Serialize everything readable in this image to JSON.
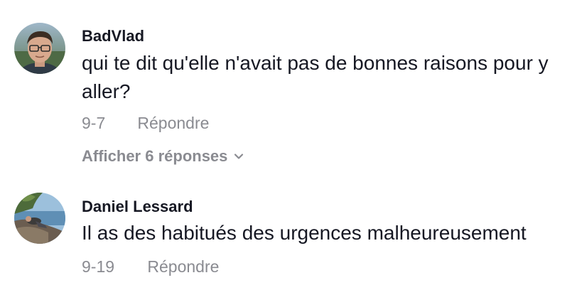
{
  "comments": [
    {
      "username": "BadVlad",
      "text": "qui te dit qu'elle n'avait pas de bonnes raisons pour y aller?",
      "date": "9-7",
      "reply_label": "Répondre",
      "replies_label": "Afficher 6 réponses",
      "avatar_icon": "man-with-glasses-photo"
    },
    {
      "username": "Daniel Lessard",
      "text": "Il as des habitués des urgences malheureusement",
      "date": "9-19",
      "reply_label": "Répondre",
      "avatar_icon": "person-on-rock-photo"
    }
  ],
  "colors": {
    "primary_text": "#161823",
    "secondary_text": "#8a8b91"
  }
}
